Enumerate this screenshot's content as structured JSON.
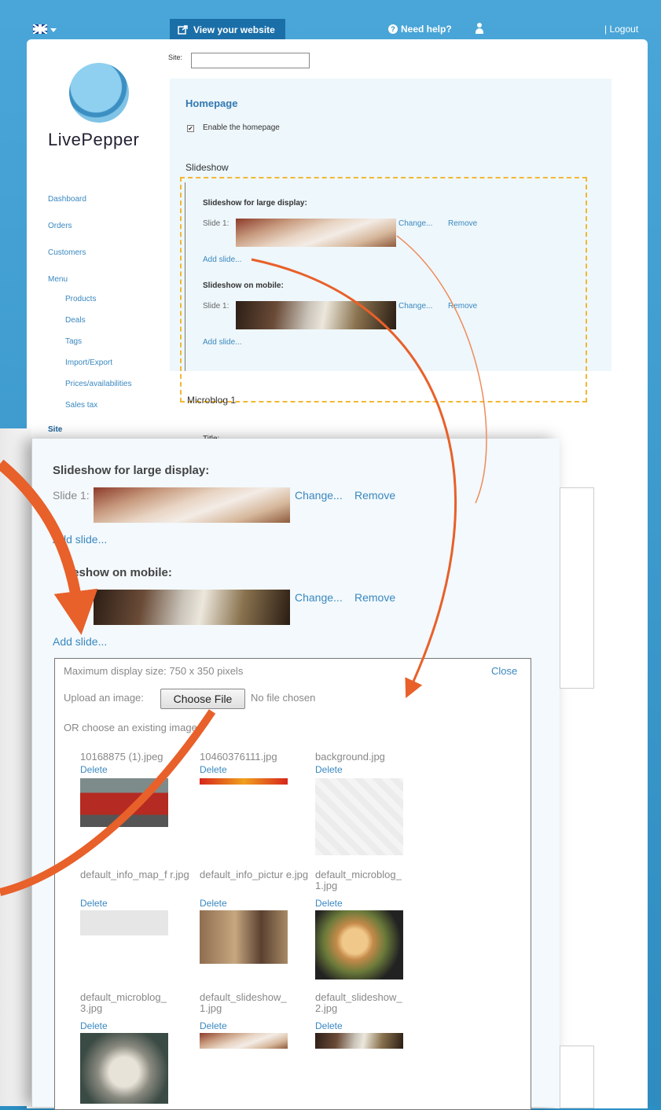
{
  "topbar": {
    "language_flag": "uk-flag-icon",
    "view_website": "View your website",
    "need_help": "Need help?",
    "logout": "| Logout"
  },
  "site": {
    "label": "Site:",
    "value": ""
  },
  "logo": {
    "text": "LivePepper"
  },
  "nav": {
    "items": [
      "Dashboard",
      "Orders",
      "Customers",
      "Menu"
    ],
    "menu_sub": [
      "Products",
      "Deals",
      "Tags",
      "Import/Export",
      "Prices/availabilities",
      "Sales tax"
    ],
    "site": "Site"
  },
  "homepage": {
    "title": "Homepage",
    "enable_label": "Enable the homepage",
    "enabled": true,
    "slideshow_title": "Slideshow",
    "large_title": "Slideshow for large display:",
    "mobile_title": "Slideshow on mobile:",
    "slide_label": "Slide 1:",
    "change": "Change...",
    "remove": "Remove",
    "add_slide": "Add slide...",
    "microblog_title": "Microblog 1",
    "title_field": "Title:"
  },
  "zoom": {
    "large_title": "Slideshow for large display:",
    "slide_label": "Slide 1:",
    "change": "Change...",
    "remove": "Remove",
    "add_slide_1": "Add slide...",
    "mobile_title_partial": "leshow on mobile:",
    "slide_label_partial": "1:",
    "add_slide_2": "Add slide...",
    "max_size": "Maximum display size: 750 x 350 pixels",
    "close": "Close",
    "upload_label": "Upload an image:",
    "choose_file": "Choose File",
    "no_file": "No file chosen",
    "or_choose": "OR choose an existing image:",
    "delete": "Delete",
    "images": [
      "10168875 (1).jpeg",
      "10460376111.jpg",
      "background.jpg",
      "default_info_map_f r.jpg",
      "default_info_pictur e.jpg",
      "default_microblog_ 1.jpg",
      "default_microblog_ 3.jpg",
      "default_slideshow_ 1.jpg",
      "default_slideshow_ 2.jpg"
    ]
  },
  "colors": {
    "accent": "#3a88c0",
    "highlight_dash": "#f2b733",
    "arrow": "#e8602a",
    "topbar_bg": "#2f8cc0"
  }
}
